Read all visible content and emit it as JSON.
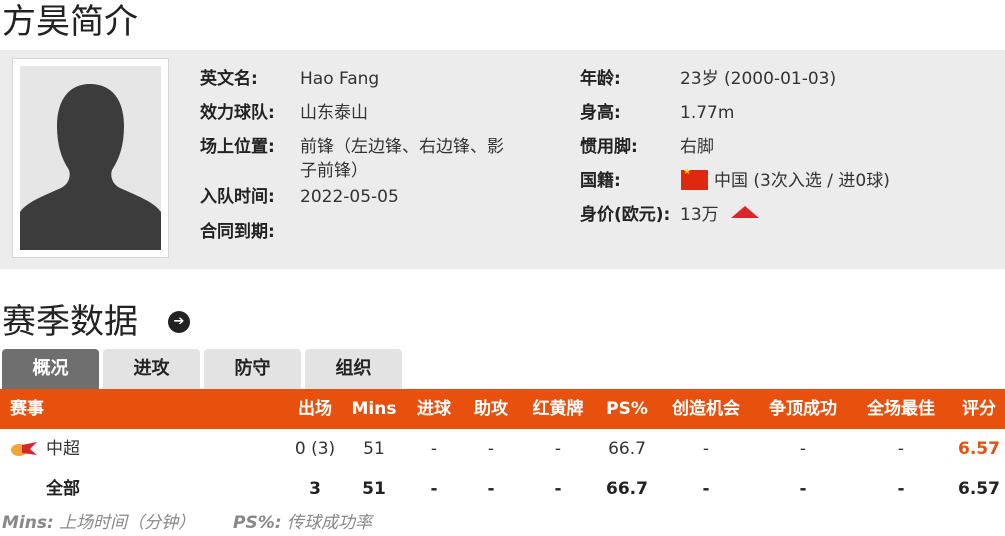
{
  "page_title": "方昊简介",
  "profile": {
    "english_name_label": "英文名:",
    "english_name": "Hao Fang",
    "club_label": "效力球队:",
    "club": "山东泰山",
    "position_label": "场上位置:",
    "position_line1": "前锋（左边锋、右边锋、影",
    "position_line2": "子前锋）",
    "joined_label": "入队时间:",
    "joined": "2022-05-05",
    "contract_label": "合同到期:",
    "contract": "",
    "age_label": "年龄:",
    "age": "23岁  (2000-01-03)",
    "height_label": "身高:",
    "height": "1.77m",
    "foot_label": "惯用脚:",
    "foot": "右脚",
    "nationality_label": "国籍:",
    "nationality": "中国 (3次入选 / 进0球)",
    "value_label": "身价(欧元):",
    "value": "13万",
    "value_trend": "up",
    "flag_color": "#de2910"
  },
  "season_title": "赛季数据",
  "tabs": [
    "概况",
    "进攻",
    "防守",
    "组织"
  ],
  "active_tab": 0,
  "table": {
    "headers": [
      "赛事",
      "出场",
      "Mins",
      "进球",
      "助攻",
      "红黄牌",
      "PS%",
      "创造机会",
      "争顶成功",
      "全场最佳",
      "评分"
    ],
    "rows": [
      {
        "competition": "中超",
        "apps": "0 (3)",
        "mins": "51",
        "goals": "-",
        "assists": "-",
        "cards": "-",
        "ps": "66.7",
        "chances": "-",
        "aerials": "-",
        "motm": "-",
        "rating": "6.57"
      },
      {
        "competition": "全部",
        "apps": "3",
        "mins": "51",
        "goals": "-",
        "assists": "-",
        "cards": "-",
        "ps": "66.7",
        "chances": "-",
        "aerials": "-",
        "motm": "-",
        "rating": "6.57"
      }
    ]
  },
  "footnote": {
    "mins_key": "Mins:",
    "mins_desc": "上场时间（分钟）",
    "ps_key": "PS%:",
    "ps_desc": "传球成功率"
  },
  "colors": {
    "accent": "#e8500e",
    "panel": "#ececec",
    "tab_active": "#6f6f6f",
    "trend_up": "#d9262b"
  }
}
